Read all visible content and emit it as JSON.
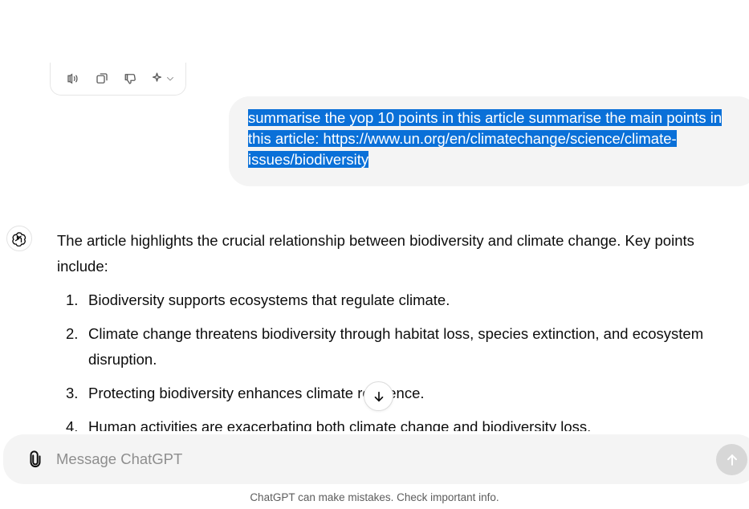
{
  "toolbar": {
    "items": [
      {
        "icon": "speaker-icon",
        "label": "Read aloud"
      },
      {
        "icon": "copy-icon",
        "label": "Copy"
      },
      {
        "icon": "thumbs-down-icon",
        "label": "Bad response"
      },
      {
        "icon": "sparkle-icon",
        "label": "Change model"
      }
    ]
  },
  "conversation": {
    "user_message": "summarise the yop 10 points in this article  summarise the main points in this article: https://www.un.org/en/climatechange/science/climate-issues/biodiversity",
    "assistant_intro": "The article highlights the crucial relationship between biodiversity and climate change. Key points include:",
    "points": [
      {
        "num": "1.",
        "text": "Biodiversity supports ecosystems that regulate climate."
      },
      {
        "num": "2.",
        "text": "Climate change threatens biodiversity through habitat loss, species extinction, and ecosystem disruption."
      },
      {
        "num": "3.",
        "text": "Protecting biodiversity enhances climate resilience."
      },
      {
        "num": "4.",
        "text": "Human activities are exacerbating both climate change and biodiversity loss."
      }
    ]
  },
  "composer": {
    "placeholder": "Message ChatGPT"
  },
  "footer": {
    "disclaimer": "ChatGPT can make mistakes. Check important info."
  },
  "colors": {
    "selection": "#0a70d8",
    "bubble": "#f4f4f4",
    "send_disabled": "#d7d7d7"
  }
}
